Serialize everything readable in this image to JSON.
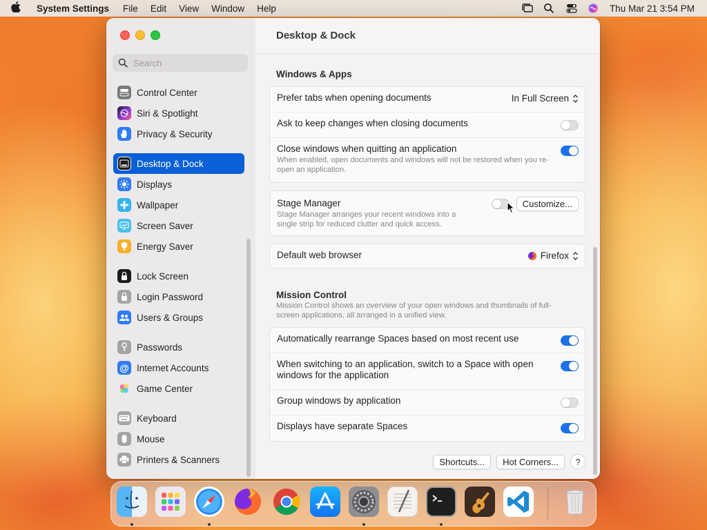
{
  "menubar": {
    "app_name": "System Settings",
    "menus": [
      "File",
      "Edit",
      "View",
      "Window",
      "Help"
    ],
    "clock": "Thu Mar 21  3:54 PM"
  },
  "sidebar": {
    "search_placeholder": "Search",
    "items": [
      {
        "label": "Control Center",
        "icon": "control-center-icon",
        "color": "#7d7a7b"
      },
      {
        "label": "Siri & Spotlight",
        "icon": "siri-icon",
        "color": "#8a3bd1"
      },
      {
        "label": "Privacy & Security",
        "icon": "hand-icon",
        "color": "#2f7cf6"
      },
      {
        "label": "Desktop & Dock",
        "icon": "dock-icon",
        "color": "#1b1b1b",
        "active": true
      },
      {
        "label": "Displays",
        "icon": "sun-icon",
        "color": "#2f7cf6"
      },
      {
        "label": "Wallpaper",
        "icon": "flower-icon",
        "color": "#36b3f0"
      },
      {
        "label": "Screen Saver",
        "icon": "screen-saver-icon",
        "color": "#48c0ea"
      },
      {
        "label": "Energy Saver",
        "icon": "bulb-icon",
        "color": "#f4b12e"
      },
      {
        "label": "Lock Screen",
        "icon": "lock-icon",
        "color": "#1b1b1b"
      },
      {
        "label": "Login Password",
        "icon": "lock-icon",
        "color": "#8e8b8c"
      },
      {
        "label": "Users & Groups",
        "icon": "users-icon",
        "color": "#2f7cf6"
      },
      {
        "label": "Passwords",
        "icon": "key-icon",
        "color": "#8e8b8c"
      },
      {
        "label": "Internet Accounts",
        "icon": "at-icon",
        "color": "#2f7cf6"
      },
      {
        "label": "Game Center",
        "icon": "game-center-icon",
        "color": "#ffffff"
      },
      {
        "label": "Keyboard",
        "icon": "keyboard-icon",
        "color": "#8e8b8c"
      },
      {
        "label": "Mouse",
        "icon": "mouse-icon",
        "color": "#8e8b8c"
      },
      {
        "label": "Printers & Scanners",
        "icon": "printer-icon",
        "color": "#8e8b8c"
      }
    ]
  },
  "main": {
    "title": "Desktop & Dock",
    "windows_apps": {
      "title": "Windows & Apps",
      "prefer_tabs": {
        "label": "Prefer tabs when opening documents",
        "value": "In Full Screen"
      },
      "ask_keep": {
        "label": "Ask to keep changes when closing documents",
        "on": false
      },
      "close_windows": {
        "label": "Close windows when quitting an application",
        "sub": "When enabled, open documents and windows will not be restored when you re-open an application.",
        "on": true
      }
    },
    "stage_manager": {
      "label": "Stage Manager",
      "sub": "Stage Manager arranges your recent windows into a single strip for reduced clutter and quick access.",
      "on": false,
      "customize": "Customize..."
    },
    "browser": {
      "label": "Default web browser",
      "value": "Firefox"
    },
    "mission_control": {
      "title": "Mission Control",
      "sub": "Mission Control shows an overview of your open windows and thumbnails of full-screen applications, all arranged in a unified view.",
      "rows": [
        {
          "label": "Automatically rearrange Spaces based on most recent use",
          "on": true
        },
        {
          "label": "When switching to an application, switch to a Space with open windows for the application",
          "on": true
        },
        {
          "label": "Group windows by application",
          "on": false
        },
        {
          "label": "Displays have separate Spaces",
          "on": true
        }
      ]
    },
    "buttons": {
      "shortcuts": "Shortcuts...",
      "hot_corners": "Hot Corners...",
      "help": "?"
    }
  },
  "dock": {
    "apps": [
      {
        "name": "finder-icon",
        "color": "#3aa0f2",
        "running": true
      },
      {
        "name": "launchpad-icon",
        "color": "#e8e6ea",
        "running": false
      },
      {
        "name": "safari-icon",
        "color": "#2f8cf0",
        "running": true
      },
      {
        "name": "firefox-icon",
        "color": "#ff7a1a",
        "running": false
      },
      {
        "name": "chrome-icon",
        "color": "#eaeaea",
        "running": false
      },
      {
        "name": "app-store-icon",
        "color": "#1d8cf5",
        "running": false
      },
      {
        "name": "system-settings-icon",
        "color": "#8e8e93",
        "running": true
      },
      {
        "name": "textedit-icon",
        "color": "#f3f1ee",
        "running": false
      },
      {
        "name": "terminal-icon",
        "color": "#1e1e1e",
        "running": true
      },
      {
        "name": "garageband-icon",
        "color": "#3a2a22",
        "running": false
      },
      {
        "name": "vscode-icon",
        "color": "#ffffff",
        "running": false
      },
      {
        "name": "trash-icon",
        "color": "#d8d8d8",
        "running": false
      }
    ]
  }
}
